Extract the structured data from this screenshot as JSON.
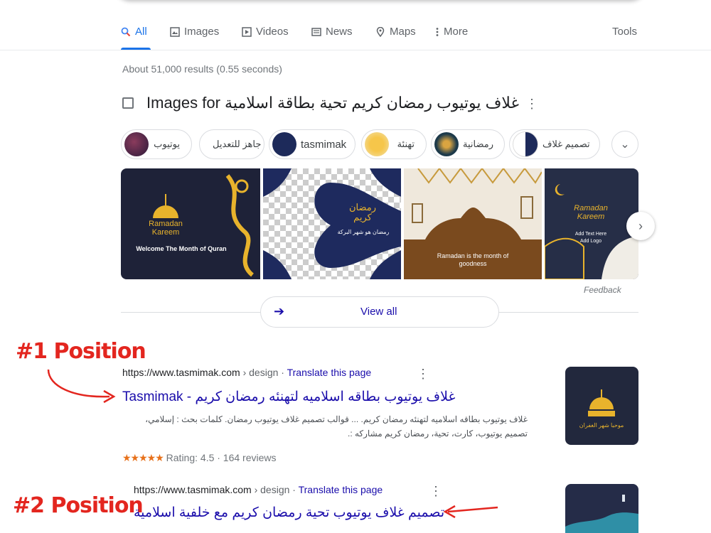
{
  "tabs": [
    {
      "label": "All",
      "icon": "search-icon"
    },
    {
      "label": "Images",
      "icon": "image-icon"
    },
    {
      "label": "Videos",
      "icon": "video-icon"
    },
    {
      "label": "News",
      "icon": "news-icon"
    },
    {
      "label": "Maps",
      "icon": "map-pin-icon"
    },
    {
      "label": "More",
      "icon": "more-vert-icon"
    }
  ],
  "tools_label": "Tools",
  "stats": "About 51,000 results (0.55 seconds)",
  "images_for": {
    "title": "Images for غلاف يوتيوب رمضان كريم تحية بطاقة اسلامية"
  },
  "chips": [
    {
      "label": "يوتيوب"
    },
    {
      "label": "جاهز للتعديل"
    },
    {
      "label": "tasmimak"
    },
    {
      "label": "تهنئة"
    },
    {
      "label": "رمضانية"
    },
    {
      "label": "تصميم غلاف"
    }
  ],
  "image_tiles": [
    {
      "line1": "Ramadan",
      "line2": "Kareem",
      "caption": "Welcome The Month of Quran"
    },
    {
      "line1": "رمضان",
      "line2": "كريم",
      "caption": "رمضان هو شهر البركة"
    },
    {
      "caption": "Ramadan is the month of goodness"
    },
    {
      "line1": "Ramadan",
      "line2": "Kareem",
      "caption": "Add Text Here",
      "caption2": "Add Logo"
    }
  ],
  "feedback": "Feedback",
  "view_all": "View all",
  "results": [
    {
      "cite_domain": "https://www.tasmimak.com",
      "cite_path": " › design",
      "translate": "Translate this page",
      "title": "غلاف يوتيوب بطاقه اسلاميه لتهنئه رمضان كريم - Tasmimak",
      "snippet1": "غلاف يوتيوب بطاقه اسلاميه لتهنئه رمضان كريم. ... قوالب تصميم غلاف يوتيوب رمضان. كلمات بحث : إسلامي،",
      "snippet2": "تصميم يوتيوب، كارت، تحية، رمضان كريم مشاركه :.",
      "rating_text": "Rating: 4.5 · 164 reviews",
      "stars": "★★★★★",
      "thumb_caption": "موحبا شهر الغفران"
    },
    {
      "cite_domain": "https://www.tasmimak.com",
      "cite_path": " › design",
      "translate": "Translate this page",
      "title": "تصميم غلاف يوتيوب تحية رمضان كريم مع خلفية اسلامية"
    }
  ],
  "annotations": {
    "pos1": "#1  Position",
    "pos2": "#2  Position"
  },
  "colors": {
    "link": "#1a0dab",
    "accent": "#1a73e8",
    "annotation": "#e3261f",
    "star": "#e7711b"
  }
}
